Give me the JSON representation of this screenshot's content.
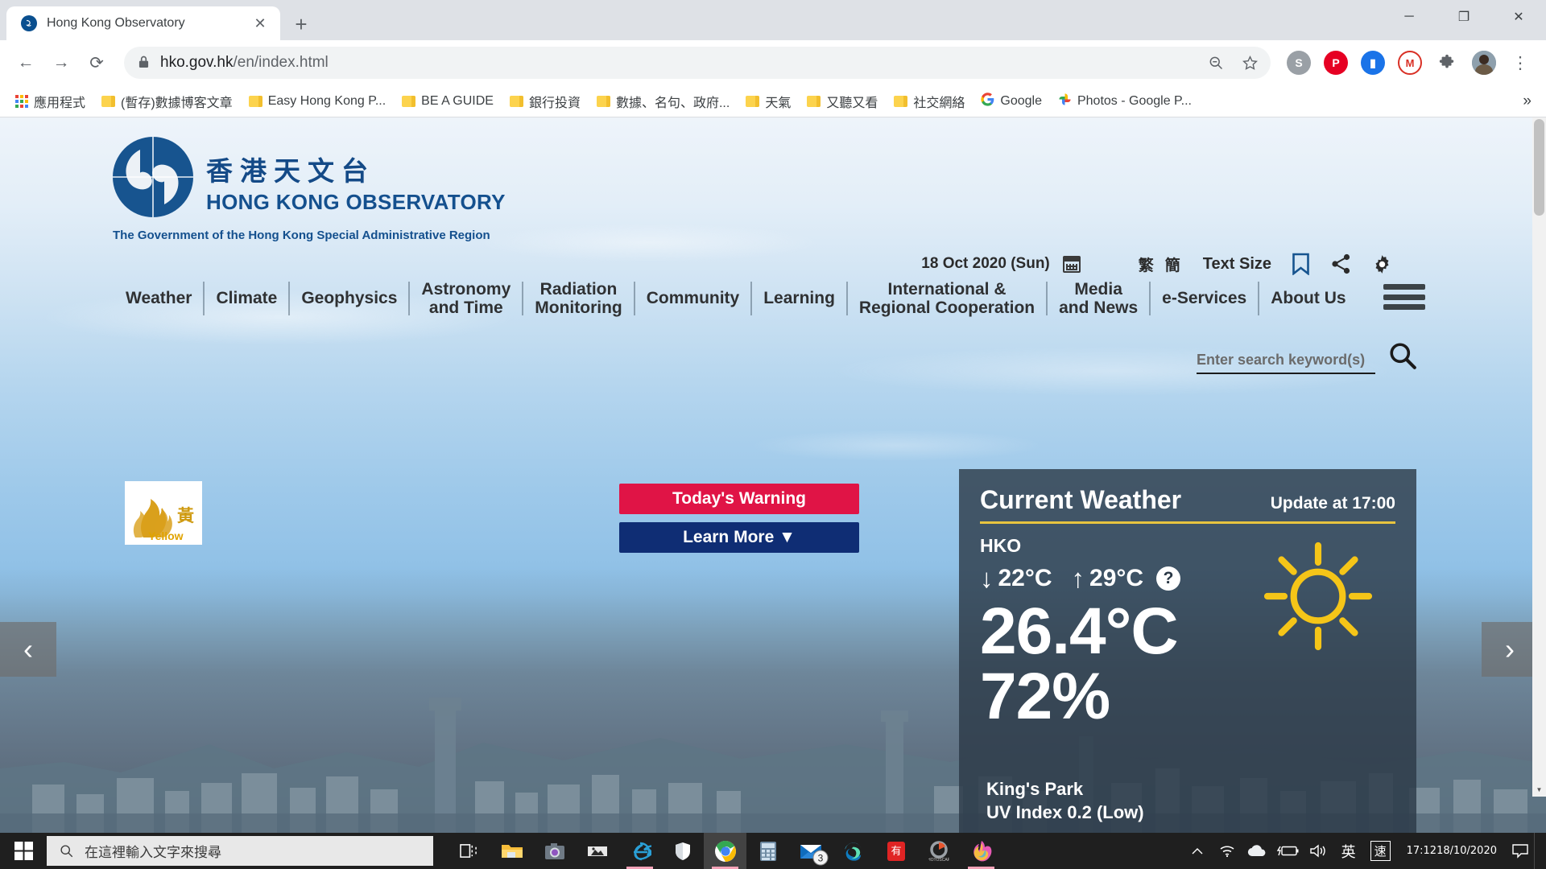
{
  "browser": {
    "tab": {
      "title": "Hong Kong Observatory",
      "favicon": "hko-favicon",
      "close_label": "✕"
    },
    "newtab_label": "+",
    "window_controls": {
      "minimize": "─",
      "maximize": "❐",
      "close": "✕"
    },
    "nav": {
      "back": "←",
      "forward": "→",
      "reload": "⟳"
    },
    "omnibox": {
      "lock_icon": "lock-icon",
      "url_domain": "hko.gov.hk",
      "url_path": "/en/index.html",
      "zoom_icon": "zoom-out-icon",
      "bookmark_icon": "star-icon"
    },
    "extensions": [
      {
        "name": "skype-extension",
        "glyph": "S",
        "color": "#9aa0a6"
      },
      {
        "name": "pinterest-extension",
        "glyph": "P",
        "color": "#e60023"
      },
      {
        "name": "pocket-extension",
        "glyph": "☑",
        "color": "#1a73e8"
      },
      {
        "name": "gmail-extension",
        "glyph": "M",
        "color": "#d93025"
      },
      {
        "name": "puzzle-extensions-icon",
        "glyph": "✦",
        "color": "#5f6368"
      }
    ],
    "profile": "user-avatar",
    "menu": "⋮",
    "bookmarks": [
      {
        "label": "應用程式",
        "icon": "apps-grid-icon"
      },
      {
        "label": "(暫存)數據博客文章",
        "icon": "folder-icon"
      },
      {
        "label": "Easy Hong Kong P...",
        "icon": "folder-icon"
      },
      {
        "label": "BE A GUIDE",
        "icon": "folder-icon"
      },
      {
        "label": "銀行投資",
        "icon": "folder-icon"
      },
      {
        "label": "數據、名句、政府...",
        "icon": "folder-icon"
      },
      {
        "label": "天氣",
        "icon": "folder-icon"
      },
      {
        "label": "又聽又看",
        "icon": "folder-icon"
      },
      {
        "label": "社交網絡",
        "icon": "folder-icon"
      },
      {
        "label": "Google",
        "icon": "google-icon"
      },
      {
        "label": "Photos - Google P...",
        "icon": "google-photos-icon"
      }
    ],
    "bookmarks_overflow": "»"
  },
  "site": {
    "logo": {
      "chinese": "香港天文台",
      "english": "HONG KONG OBSERVATORY",
      "gov_line": "The Government of the Hong Kong Special Administrative Region",
      "brand_color": "#14508e"
    },
    "utility": {
      "date": "18 Oct 2020 (Sun)",
      "calendar_icon": "calendar-icon",
      "lang_trad": "繁",
      "lang_simp": "簡",
      "text_size": "Text Size",
      "bookmark_icon": "bookmark-icon",
      "share_icon": "share-icon",
      "settings_icon": "gear-icon"
    },
    "search": {
      "placeholder": "Enter search keyword(s)",
      "value": "",
      "icon": "search-icon"
    },
    "nav": [
      {
        "label": "Weather"
      },
      {
        "label": "Climate"
      },
      {
        "label": "Geophysics"
      },
      {
        "label": "Astronomy\nand Time",
        "line1": "Astronomy",
        "line2": "and Time"
      },
      {
        "label": "Radiation\nMonitoring",
        "line1": "Radiation",
        "line2": "Monitoring"
      },
      {
        "label": "Community"
      },
      {
        "label": "Learning"
      },
      {
        "label": "International &\nRegional Cooperation",
        "line1": "International &",
        "line2": "Regional Cooperation"
      },
      {
        "label": "Media\nand News",
        "line1": "Media",
        "line2": "and News"
      },
      {
        "label": "e-Services"
      },
      {
        "label": "About Us"
      }
    ],
    "menu_icon": "hamburger-menu-icon",
    "warning": {
      "icon_name": "yellow-fire-danger-warning-icon",
      "icon_zh": "黃",
      "icon_en": "Yellow",
      "today_button": "Today's Warning",
      "today_button_color": "#e01446",
      "learn_more_button": "Learn More",
      "learn_more_color": "#0f2d74",
      "caret": "▼"
    },
    "carousel": {
      "prev": "‹",
      "next": "›"
    },
    "current_weather": {
      "title": "Current Weather",
      "update": "Update at 17:00",
      "station": "HKO",
      "min_arrow": "↓",
      "min_temp": "22°C",
      "max_arrow": "↑",
      "max_temp": "29°C",
      "help_icon": "question-mark-icon",
      "weather_icon": "sunny-icon",
      "temperature": "26.4°C",
      "humidity": "72%",
      "uv_station": "King's Park",
      "uv_index": "UV Index 0.2 (Low)",
      "accent_color": "#e8c53f"
    }
  },
  "taskbar": {
    "start": "windows-start-icon",
    "search_placeholder": "在這裡輸入文字來搜尋",
    "search_icon": "search-icon",
    "apps": [
      {
        "name": "task-view-icon"
      },
      {
        "name": "file-explorer-icon"
      },
      {
        "name": "camera-icon"
      },
      {
        "name": "video-editor-icon"
      },
      {
        "name": "internet-explorer-icon"
      },
      {
        "name": "windows-security-icon"
      },
      {
        "name": "google-chrome-icon"
      },
      {
        "name": "calculator-icon"
      },
      {
        "name": "mail-icon",
        "badge": "3"
      },
      {
        "name": "microsoft-edge-icon"
      },
      {
        "name": "youdao-dictionary-icon"
      },
      {
        "name": "photoscape-icon"
      },
      {
        "name": "firefox-icon"
      }
    ],
    "tray": {
      "chevron": "∧",
      "wifi_icon": "wifi-icon",
      "onedrive_icon": "onedrive-icon",
      "battery_icon": "battery-charging-icon",
      "volume_icon": "volume-icon",
      "ime_lang": "英",
      "ime_mode": "速",
      "time": "17:12",
      "date": "18/10/2020",
      "action_center_icon": "notification-icon"
    }
  }
}
